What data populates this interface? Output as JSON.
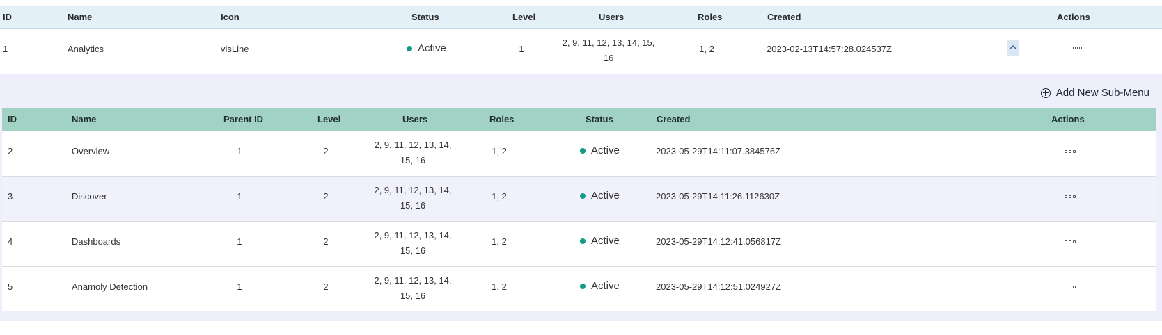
{
  "main_table": {
    "headers": {
      "id": "ID",
      "name": "Name",
      "icon": "Icon",
      "status": "Status",
      "level": "Level",
      "users": "Users",
      "roles": "Roles",
      "created": "Created",
      "actions": "Actions"
    },
    "row": {
      "id": "1",
      "name": "Analytics",
      "icon": "visLine",
      "status": "Active",
      "level": "1",
      "users_line1": "2, 9, 11, 12, 13, 14, 15,",
      "users_line2": "16",
      "roles": "1, 2",
      "created": "2023-02-13T14:57:28.024537Z",
      "expand_icon": "chevron-up-icon",
      "actions_icon": "more-icon"
    }
  },
  "sub_menu": {
    "add_label": "Add New Sub-Menu",
    "add_icon": "plus-circle-icon",
    "headers": {
      "id": "ID",
      "name": "Name",
      "parent_id": "Parent ID",
      "level": "Level",
      "users": "Users",
      "roles": "Roles",
      "status": "Status",
      "created": "Created",
      "actions": "Actions"
    },
    "rows": [
      {
        "id": "2",
        "name": "Overview",
        "parent_id": "1",
        "level": "2",
        "users_line1": "2, 9, 11, 12, 13, 14,",
        "users_line2": "15, 16",
        "roles": "1, 2",
        "status": "Active",
        "created": "2023-05-29T14:11:07.384576Z"
      },
      {
        "id": "3",
        "name": "Discover",
        "parent_id": "1",
        "level": "2",
        "users_line1": "2, 9, 11, 12, 13, 14,",
        "users_line2": "15, 16",
        "roles": "1, 2",
        "status": "Active",
        "created": "2023-05-29T14:11:26.112630Z"
      },
      {
        "id": "4",
        "name": "Dashboards",
        "parent_id": "1",
        "level": "2",
        "users_line1": "2, 9, 11, 12, 13, 14,",
        "users_line2": "15, 16",
        "roles": "1, 2",
        "status": "Active",
        "created": "2023-05-29T14:12:41.056817Z"
      },
      {
        "id": "5",
        "name": "Anamoly Detection",
        "parent_id": "1",
        "level": "2",
        "users_line1": "2, 9, 11, 12, 13, 14,",
        "users_line2": "15, 16",
        "roles": "1, 2",
        "status": "Active",
        "created": "2023-05-29T14:12:51.024927Z"
      }
    ]
  },
  "colors": {
    "main_header_bg": "#e3f0f8",
    "sub_header_bg": "#a2d2c4",
    "panel_bg": "#efeffb",
    "status_dot": "#159a86"
  }
}
